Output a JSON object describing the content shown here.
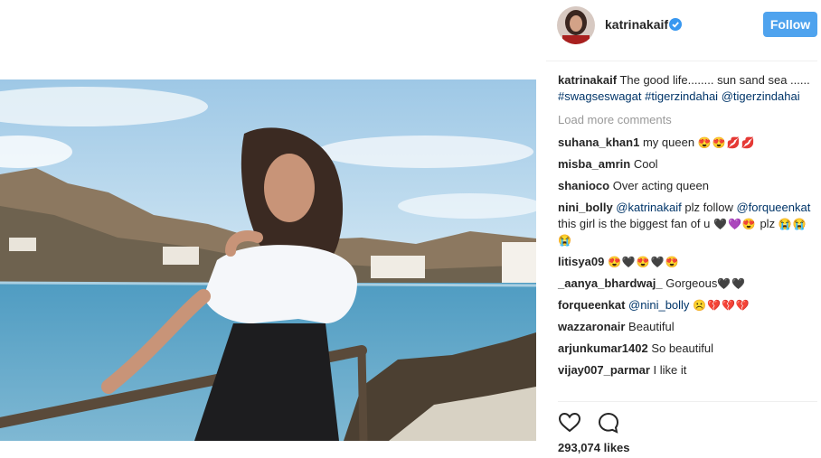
{
  "post": {
    "username": "katrinakaif",
    "verified": true,
    "follow_label": "Follow",
    "caption": {
      "user": "katrinakaif",
      "text": "The good life........ sun sand sea ......",
      "tags": [
        "#swagseswagat",
        "#tigerzindahai",
        "@tigerzindahai"
      ]
    },
    "load_more_label": "Load more comments",
    "comments": [
      {
        "user": "suhana_khan1",
        "text": "my queen",
        "emoji": "😍😍💋💋"
      },
      {
        "user": "misba_amrin",
        "text": "Cool",
        "emoji": ""
      },
      {
        "user": "shanioco",
        "text": "Over acting queen",
        "emoji": ""
      },
      {
        "user": "nini_bolly",
        "mention": "@katrinakaif",
        "text": "plz follow",
        "mention2": "@forqueenkat",
        "text2": "this girl is the biggest fan of u",
        "emoji": "🖤💜😍",
        "text3": "plz",
        "emoji2": "😭😭😭"
      },
      {
        "user": "litisya09",
        "text": "",
        "emoji": "😍🖤😍🖤😍"
      },
      {
        "user": "_aanya_bhardwaj_",
        "text": "Gorgeous",
        "emoji": "🖤🖤"
      },
      {
        "user": "forqueenkat",
        "mention": "@nini_bolly",
        "text": "",
        "emoji": "☹️💔💔💔"
      },
      {
        "user": "wazzaronair",
        "text": "Beautiful",
        "emoji": ""
      },
      {
        "user": "arjunkumar1402",
        "text": "So beautiful",
        "emoji": ""
      },
      {
        "user": "vijay007_parmar",
        "text": "I like it",
        "emoji": ""
      }
    ],
    "likes": "293,074 likes"
  },
  "icons": {
    "like": "heart-icon",
    "comment": "comment-bubble-icon",
    "verified": "verified-badge-icon"
  },
  "colors": {
    "follow_button": "#4fa3ee",
    "hashtag": "#003569",
    "muted": "#999999",
    "verified": "#3897f0"
  }
}
